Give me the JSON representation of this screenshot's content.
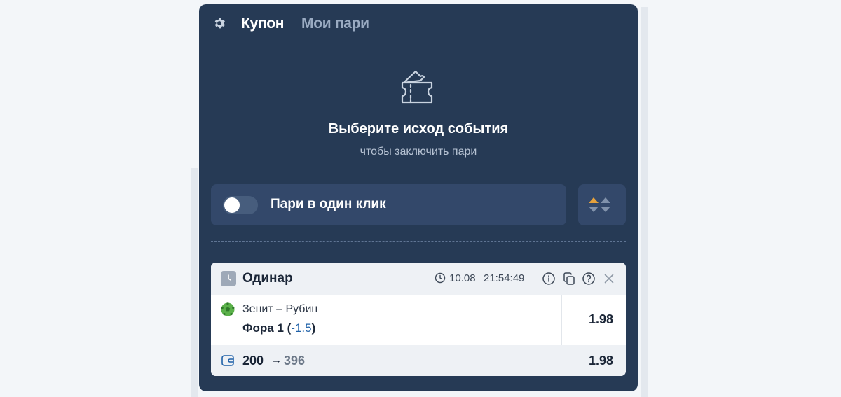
{
  "tabs": {
    "active": "Купон",
    "inactive": "Мои пари"
  },
  "empty_state": {
    "title": "Выберите исход события",
    "subtitle": "чтобы заключить пари"
  },
  "one_click": {
    "label": "Пари в один клик",
    "enabled": false
  },
  "bet": {
    "type": "Одинар",
    "date": "10.08",
    "time": "21:54:49",
    "match": "Зенит – Рубин",
    "market_prefix": "Фора 1 (",
    "handicap": "-1.5",
    "market_suffix": ")",
    "odds": "1.98",
    "stake": "200",
    "arrow": "→",
    "payout": "396",
    "total_odds": "1.98"
  },
  "icons": {
    "settings": "gear-icon",
    "empty": "ticket-icon",
    "sort": "sort-arrows-icon",
    "type": "clock-icon",
    "time": "clock-icon",
    "info": "info-icon",
    "copy": "copy-icon",
    "help": "help-icon",
    "close": "close-icon",
    "sport": "football-icon",
    "stake": "wallet-icon"
  },
  "colors": {
    "panel_bg": "#263a55",
    "tab_inactive": "#9aabc2",
    "accent_orange": "#e6a23c",
    "handicap_blue": "#1f61a8"
  }
}
